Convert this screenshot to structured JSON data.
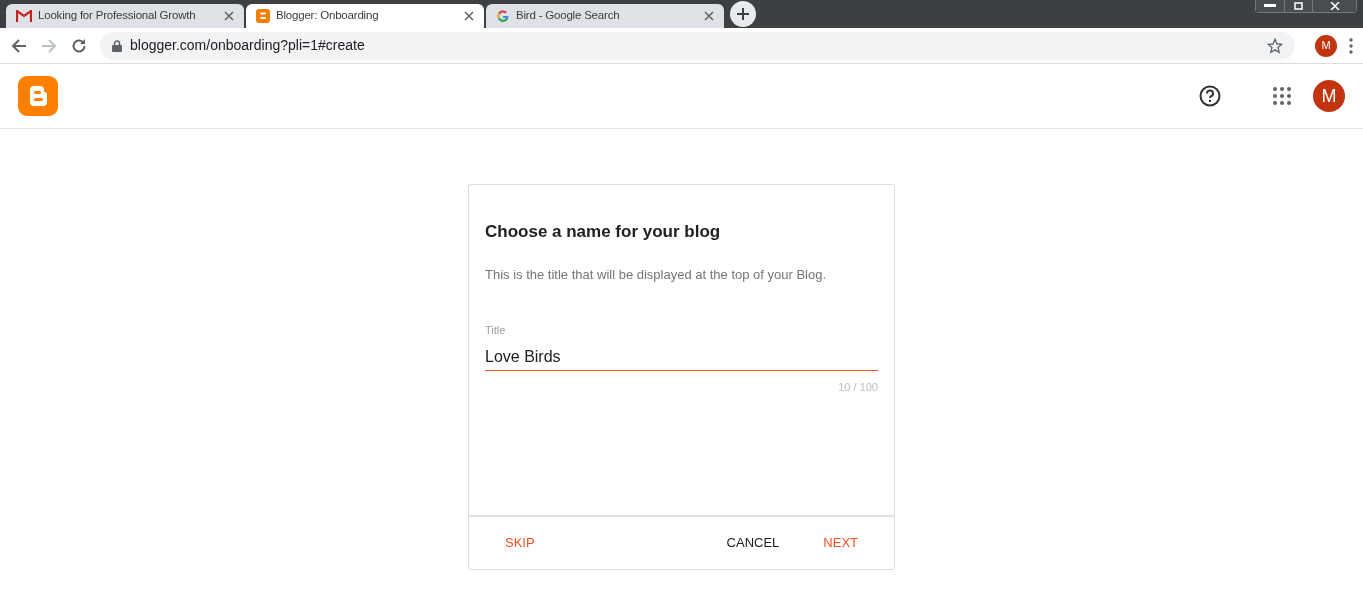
{
  "browser": {
    "tabs": [
      {
        "title": "Looking for Professional Growth",
        "kind": "gmail",
        "selected": false
      },
      {
        "title": "Blogger: Onboarding",
        "kind": "blogger",
        "selected": true
      },
      {
        "title": "Bird - Google Search",
        "kind": "google",
        "selected": false
      }
    ],
    "url": "blogger.com/onboarding?pli=1#create",
    "profile_initial": "M"
  },
  "header": {
    "avatar_initial": "M"
  },
  "dialog": {
    "title": "Choose a name for your blog",
    "description": "This is the title that will be displayed at the top of your Blog.",
    "field": {
      "label": "Title",
      "value": "Love Birds",
      "counter": "10 / 100"
    },
    "buttons": [
      {
        "label": "SKIP",
        "kind": "accent"
      },
      {
        "label": "CANCEL",
        "kind": "neutral"
      },
      {
        "label": "NEXT",
        "kind": "accent"
      }
    ]
  }
}
